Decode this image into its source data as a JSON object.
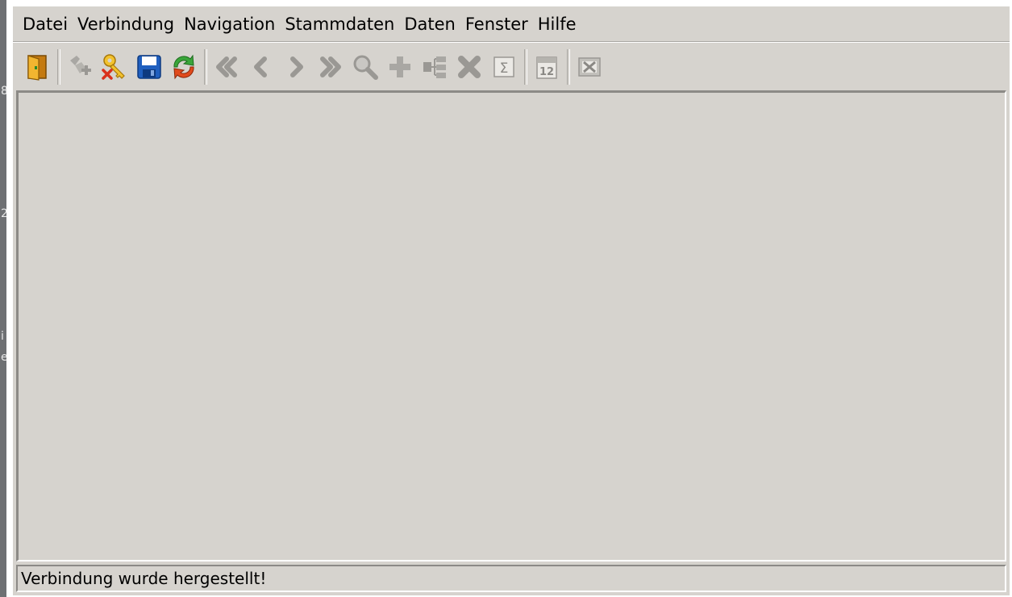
{
  "menu": {
    "items": [
      {
        "label": "Datei"
      },
      {
        "label": "Verbindung"
      },
      {
        "label": "Navigation"
      },
      {
        "label": "Stammdaten"
      },
      {
        "label": "Daten"
      },
      {
        "label": "Fenster"
      },
      {
        "label": "Hilfe"
      }
    ]
  },
  "toolbar": {
    "buttons": [
      {
        "icon": "exit-door-icon",
        "enabled": true
      },
      {
        "icon": "connect-plug-icon",
        "enabled": false
      },
      {
        "icon": "disconnect-key-icon",
        "enabled": true
      },
      {
        "icon": "save-disk-icon",
        "enabled": true
      },
      {
        "icon": "refresh-icon",
        "enabled": true
      },
      {
        "icon": "first-record-icon",
        "enabled": false
      },
      {
        "icon": "previous-record-icon",
        "enabled": false
      },
      {
        "icon": "next-record-icon",
        "enabled": false
      },
      {
        "icon": "last-record-icon",
        "enabled": false
      },
      {
        "icon": "search-icon",
        "enabled": false
      },
      {
        "icon": "add-record-icon",
        "enabled": false
      },
      {
        "icon": "hierarchy-icon",
        "enabled": false
      },
      {
        "icon": "delete-record-icon",
        "enabled": false
      },
      {
        "icon": "sum-icon",
        "enabled": false
      },
      {
        "icon": "calendar-icon",
        "enabled": false
      },
      {
        "icon": "excel-export-icon",
        "enabled": false
      }
    ]
  },
  "left_edge_fragments": [
    "8",
    "2",
    "i",
    "e"
  ],
  "status": {
    "text": "Verbindung wurde hergestellt!"
  },
  "colors": {
    "window_bg": "#d6d3ce",
    "disabled_icon": "#9a9894",
    "accent_orange": "#e8a019",
    "accent_blue": "#1f5fbf",
    "accent_green": "#3aa53a",
    "accent_red": "#d9301c"
  }
}
